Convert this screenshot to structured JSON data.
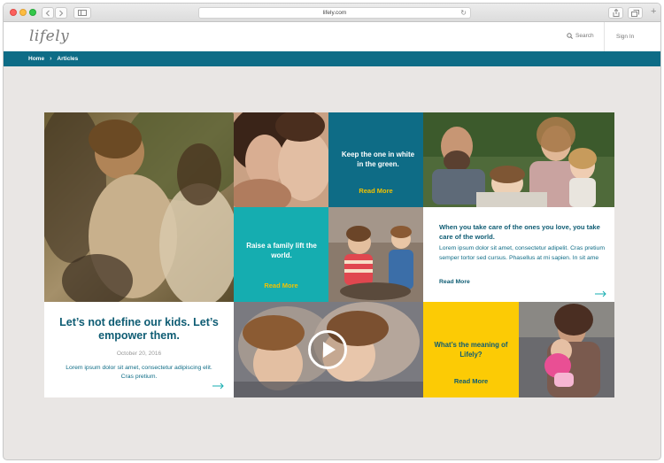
{
  "browser": {
    "url": "lifely.com",
    "back_icon": "chevron-left-icon",
    "forward_icon": "chevron-right-icon",
    "sidebar_icon": "sidebar-icon",
    "reload_icon": "reload-icon",
    "share_icon": "share-icon",
    "tabs_icon": "tabs-icon",
    "new_tab_icon": "plus-icon"
  },
  "header": {
    "logo": "lifely",
    "search_label": "Search",
    "signin_label": "Sign In"
  },
  "breadcrumb": {
    "home": "Home",
    "separator": "›",
    "current": "Articles"
  },
  "tiles": {
    "feature": {
      "headline": "Let’s not define our kids. Let’s empower them.",
      "date": "October 20, 2016",
      "excerpt": "Lorem ipsum dolor sit amet, consectetur adipiscing elit. Cras pretium."
    },
    "green_white": {
      "headline": "Keep the one in white in the green.",
      "read_more": "Read More"
    },
    "raise_family": {
      "headline": "Raise a family lift the world.",
      "read_more": "Read More"
    },
    "care": {
      "headline": "When you take care of the ones you love, you take care of the world.",
      "excerpt": "Lorem ipsum dolor sit amet, consectetur adipelit. Cras pretium semper tortor sed cursus. Phasellus at mi sapien. In sit ame",
      "read_more": "Read More"
    },
    "meaning": {
      "headline": "What’s the meaning of Lifely?",
      "read_more": "Read More"
    }
  },
  "colors": {
    "brand_teal": "#0e6c86",
    "aqua": "#15adb0",
    "yellow": "#fccb05",
    "gold_text": "#f2c200"
  }
}
